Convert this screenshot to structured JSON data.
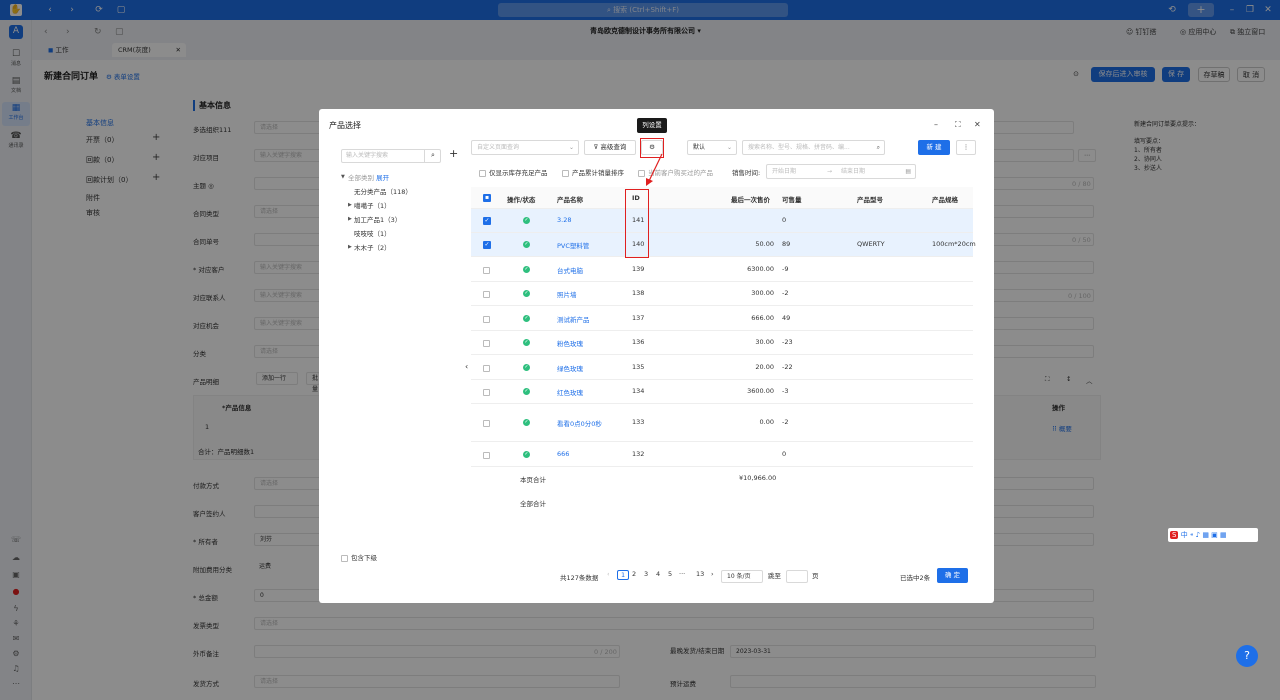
{
  "top": {
    "search_placeholder": "搜索 (Ctrl+Shift+F)"
  },
  "rail": [
    {
      "label": "消息",
      "icon": "☐"
    },
    {
      "label": "文档",
      "icon": "▤"
    },
    {
      "label": "工作台",
      "icon": "▦"
    },
    {
      "label": "通讯录",
      "icon": "☎"
    }
  ],
  "tabs": {
    "work": "工作",
    "crm": "CRM(灰度)"
  },
  "company": "青岛欧克德制设计事务所有限公司",
  "rightlinks": {
    "dingding": "钉钉搭",
    "app": "应用中心",
    "standalone": "独立窗口"
  },
  "page": {
    "title": "新建合同订单",
    "subtitle": "表单设置",
    "buttons": {
      "save_approve": "保存后进入审核",
      "save": "保 存",
      "draft": "存草稿",
      "cancel": "取 消"
    },
    "nav": [
      "基本信息",
      "开票（0）",
      "回款（0）",
      "回款计划（0）",
      "附件",
      "审核"
    ],
    "section": "基本信息",
    "fields": [
      {
        "label": "多选组织111",
        "ph": "请选择"
      },
      {
        "label": "对应项目",
        "ph": "输入关键字搜索"
      },
      {
        "label": "主题 ◎",
        "ph": ""
      },
      {
        "label": "合同类型",
        "ph": "请选择"
      },
      {
        "label": "合同单号",
        "ph": ""
      },
      {
        "label": "* 对应客户",
        "ph": "输入关键字搜索"
      },
      {
        "label": "对应联系人",
        "ph": "输入关键字搜索"
      },
      {
        "label": "对应机会",
        "ph": "输入关键字搜索"
      },
      {
        "label": "分类",
        "ph": "请选择"
      }
    ],
    "lower_fields": [
      {
        "label": "付款方式",
        "ph": "请选择"
      },
      {
        "label": "客户签约人",
        "ph": ""
      },
      {
        "label": "* 所有者",
        "ph": "刘芬"
      },
      {
        "label": "附加费用分类",
        "ph": "运费"
      },
      {
        "label": "* 总金额",
        "ph": "0"
      },
      {
        "label": "发票类型",
        "ph": "请选择"
      },
      {
        "label": "外币备注",
        "ph": ""
      },
      {
        "label": "发货方式",
        "ph": "请选择"
      }
    ],
    "detail": {
      "label": "产品明细",
      "add_row": "添加一行",
      "batch": "批量",
      "col_info": "*产品信息",
      "col_op": "操作",
      "row_no": "1",
      "summary": "合计：产品明细数1",
      "op_link": "概要"
    },
    "counters": {
      "c80": "0 / 80",
      "c50": "0 / 50",
      "c100": "0 / 100",
      "c200": "0 / 200"
    },
    "ship_end": {
      "label": "最晚发货/结束日期",
      "value": "2023-03-31"
    },
    "estimate": "预计运费",
    "tips": {
      "title": "新建合同订单要点提示：",
      "lines": [
        "填写要点：",
        "1、所有者",
        "2、协同人",
        "3、抄送人"
      ]
    }
  },
  "modal": {
    "title": "产品选择",
    "tree_search_ph": "输入关键字搜索",
    "tree": {
      "root": "全部类别",
      "expand": "展开",
      "items": [
        "无分类产品（118）",
        "噶噶子（1）",
        "加工产品1（3）",
        "吱吱吱（1）",
        "木木子（2）"
      ]
    },
    "include_sub": "包含下级",
    "filter_sel_ph": "自定义页面查询",
    "adv_query": "高级查询",
    "sort_sel": "默认",
    "search_ph": "搜索名称、型号、规格、拼音码、编...",
    "new": "新 建",
    "more": "⋮",
    "opts": {
      "stock": "仅显示库存充足产品",
      "cumulative": "产品累计销量排序",
      "bought": "当前客户购买过的产品",
      "time": "销售时间:",
      "start": "开始日期",
      "end": "结束日期"
    },
    "cols": {
      "op": "操作/状态",
      "name": "产品名称",
      "id": "ID",
      "lastprice": "最后一次售价",
      "sellable": "可售量",
      "model": "产品型号",
      "spec": "产品规格"
    },
    "rows": [
      {
        "name": "3.28",
        "id": "141",
        "price": "",
        "qty": "0",
        "model": "",
        "spec": "",
        "sel": true
      },
      {
        "name": "PVC塑料管",
        "id": "140",
        "price": "50.00",
        "qty": "89",
        "model": "QWERTY",
        "spec": "100cm*20cm",
        "sel": true
      },
      {
        "name": "台式电脑",
        "id": "139",
        "price": "6300.00",
        "qty": "-9",
        "model": "",
        "spec": "",
        "sel": false
      },
      {
        "name": "照片墙",
        "id": "138",
        "price": "300.00",
        "qty": "-2",
        "model": "",
        "spec": "",
        "sel": false
      },
      {
        "name": "测试新产品",
        "id": "137",
        "price": "666.00",
        "qty": "49",
        "model": "",
        "spec": "",
        "sel": false
      },
      {
        "name": "粉色玫瑰",
        "id": "136",
        "price": "30.00",
        "qty": "-23",
        "model": "",
        "spec": "",
        "sel": false
      },
      {
        "name": "绿色玫瑰",
        "id": "135",
        "price": "20.00",
        "qty": "-22",
        "model": "",
        "spec": "",
        "sel": false
      },
      {
        "name": "红色玫瑰",
        "id": "134",
        "price": "3600.00",
        "qty": "-3",
        "model": "",
        "spec": "",
        "sel": false
      },
      {
        "name": "看看0点0分0秒",
        "id": "133",
        "price": "0.00",
        "qty": "-2",
        "model": "",
        "spec": "",
        "sel": false
      },
      {
        "name": "666",
        "id": "132",
        "price": "",
        "qty": "0",
        "model": "",
        "spec": "",
        "sel": false
      }
    ],
    "page_total_label": "本页合计",
    "page_total": "¥10,966.00",
    "all_total_label": "全部合计",
    "pager": {
      "total": "共127条数据",
      "pages": [
        "1",
        "2",
        "3",
        "4",
        "5",
        "···",
        "13"
      ],
      "size": "10 条/页",
      "jump": "跳至",
      "page": "页"
    },
    "selected": "已选中2条",
    "confirm": "确 定",
    "callout": "列设置"
  },
  "ime_text": "中 ⁌ ♪ ▦ ▣ ▦",
  "help": "?"
}
